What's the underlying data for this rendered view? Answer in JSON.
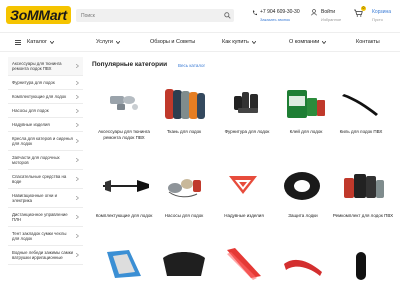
{
  "header": {
    "logo_text": "ЗоММаrt",
    "search_placeholder": "Поиск",
    "phone": "+7 904 609-30-30",
    "call_request": "Заказать звонок",
    "login_label": "Войти",
    "login_sub": "Избранное",
    "cart_label": "Корзина",
    "cart_sum": "Пусто",
    "cart_count": "0"
  },
  "nav": {
    "items": [
      {
        "label": "Каталог"
      },
      {
        "label": "Услуги"
      },
      {
        "label": "Обзоры и Советы"
      },
      {
        "label": "Как купить"
      },
      {
        "label": "О компании"
      },
      {
        "label": "Контакты"
      }
    ]
  },
  "sidebar": {
    "items": [
      {
        "label": "Аксессуары для тюнинга ремонта лодок ПВХ"
      },
      {
        "label": "Фурнитура для лодок"
      },
      {
        "label": "Комплектующие для лодок"
      },
      {
        "label": "Насосы для лодок"
      },
      {
        "label": "Надувные изделия"
      },
      {
        "label": "Кресла для катеров и сиденья для лодок"
      },
      {
        "label": "Запчасти для лодочных моторов"
      },
      {
        "label": "Спасательные средства на воде"
      },
      {
        "label": "Навигационные огни и электрика"
      },
      {
        "label": "Дистанционное управление ПЛН"
      },
      {
        "label": "Тент закладок сумки чехлы для лодок"
      },
      {
        "label": "Водные лебеди зажимы самки ватрушки ирригационные"
      }
    ]
  },
  "main": {
    "title": "Популярные категории",
    "all_link": "Весь каталог",
    "categories": [
      {
        "label": "Аксессуары для тюнинга ремонта лодок ПВХ"
      },
      {
        "label": "Ткань для лодок"
      },
      {
        "label": "Фурнитура для лодок"
      },
      {
        "label": "Клей для лодок"
      },
      {
        "label": "Киль для лодок ПВХ"
      },
      {
        "label": "Комплектующие для лодок"
      },
      {
        "label": "Насосы для лодок"
      },
      {
        "label": "Надувные изделия"
      },
      {
        "label": "Защита лодки"
      },
      {
        "label": "Ремкомплект для лодок ПВХ"
      }
    ]
  },
  "colors": {
    "accent": "#f5c400",
    "link": "#3a7bd5"
  }
}
